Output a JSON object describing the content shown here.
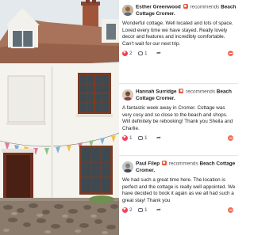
{
  "reviews": [
    {
      "author": "Esther Greenwood",
      "verb": "recommends",
      "place": "Beach Cottage Cromer.",
      "text": "Wonderful cottage. Well located and lots of space. Loved every time we have stayed. Really lovely decor and features and incredibly comfortable. Can't wait for our next trip.",
      "reactions": "2",
      "comments": "1"
    },
    {
      "author": "Hannah Surridge",
      "verb": "recommends",
      "place": "Beach Cottage Cromer.",
      "text": "A fantastic week away in Cromer. Cottage was very cosy and so close to the beach and shops. Will definitely be rebooking! Thank you Sheila and Charlie.",
      "reactions": "1",
      "comments": "1"
    },
    {
      "author": "Paul Filep",
      "verb": "recommends",
      "place": "Beach Cottage Cromer.",
      "text": "We had such a great time here. The location is perfect and the cottage is really well appointed. We have decided to book it again as we all had such a great stay! Thank you",
      "reactions": "2",
      "comments": "1"
    }
  ],
  "colors": {
    "recommend": "#e9573e",
    "heart": "#f33e58",
    "text": "#1c1e21"
  }
}
